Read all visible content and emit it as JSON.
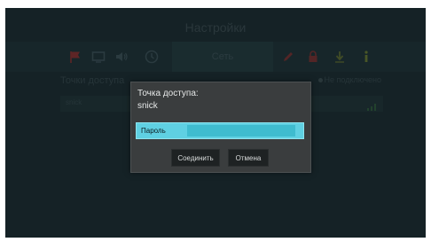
{
  "header": {
    "title": "Настройки"
  },
  "toolbar": {
    "active_tab_label": "Сеть",
    "icons": [
      "flag-icon",
      "display-icon",
      "speaker-icon",
      "clock-icon",
      "network-tab",
      "pencil-icon",
      "lock-icon",
      "download-icon",
      "info-icon"
    ],
    "colors": {
      "flag": "#8a2f2f",
      "pencil": "#7a2f2f",
      "lock": "#7a2f2f",
      "download": "#5f6a2f",
      "info": "#6a7a2f",
      "dim_icon": "#3d5157"
    }
  },
  "main": {
    "access_points_label": "Точки доступа",
    "connection_status": "Не подключено",
    "access_points": [
      {
        "name": "snick"
      }
    ]
  },
  "dialog": {
    "heading": "Точка доступа:",
    "ssid": "snick",
    "password_placeholder": "Пароль",
    "connect_label": "Соединить",
    "cancel_label": "Отмена",
    "accent_color": "#5fd0e2"
  }
}
